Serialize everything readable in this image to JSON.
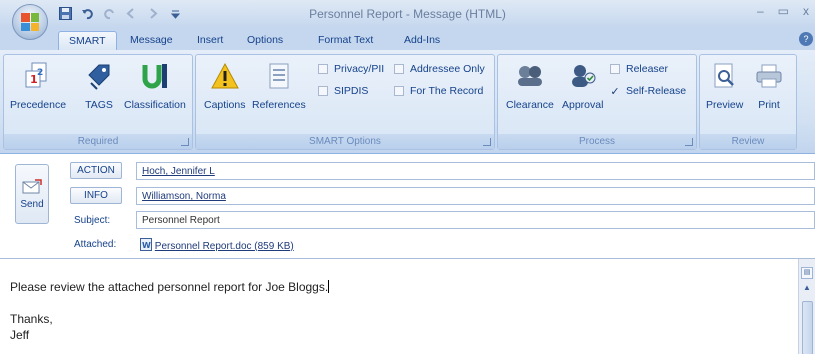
{
  "window": {
    "title": "Personnel Report - Message (HTML)",
    "minimize": "–",
    "restore": "▭",
    "close": "x"
  },
  "quick_access": [
    "save-icon",
    "undo-icon",
    "redo-icon",
    "back-icon",
    "forward-icon",
    "customize-icon"
  ],
  "tabs": [
    {
      "label": "SMART",
      "active": true
    },
    {
      "label": "Message"
    },
    {
      "label": "Insert"
    },
    {
      "label": "Options"
    },
    {
      "label": "Format Text"
    },
    {
      "label": "Add-Ins"
    }
  ],
  "ribbon": {
    "required": {
      "label": "Required",
      "buttons": [
        {
          "label": "Precedence",
          "icon": "precedence-icon"
        },
        {
          "label": "TAGS",
          "icon": "tags-icon"
        },
        {
          "label": "Classification",
          "icon": "classification-icon"
        }
      ]
    },
    "smart_options": {
      "label": "SMART Options",
      "buttons": [
        {
          "label": "Captions",
          "icon": "warning-icon"
        },
        {
          "label": "References",
          "icon": "document-icon"
        }
      ],
      "checkboxes": [
        {
          "label": "Privacy/PII",
          "checked": false
        },
        {
          "label": "SIPDIS",
          "checked": false
        },
        {
          "label": "Addressee Only",
          "checked": false
        },
        {
          "label": "For The Record",
          "checked": false
        }
      ]
    },
    "process": {
      "label": "Process",
      "buttons": [
        {
          "label": "Clearance",
          "icon": "clearance-icon"
        },
        {
          "label": "Approval",
          "icon": "approval-icon"
        }
      ],
      "checkboxes": [
        {
          "label": "Releaser",
          "checked": false
        },
        {
          "label": "Self-Release",
          "checked": true
        }
      ]
    },
    "review": {
      "label": "Review",
      "buttons": [
        {
          "label": "Preview",
          "icon": "preview-icon"
        },
        {
          "label": "Print",
          "icon": "print-icon"
        }
      ]
    }
  },
  "header": {
    "send_label": "Send",
    "action_label": "ACTION",
    "action_value": "Hoch, Jennifer L",
    "info_label": "INFO",
    "info_value": "Williamson, Norma",
    "subject_label": "Subject:",
    "subject_value": "Personnel Report",
    "attached_label": "Attached:",
    "attached_value": "Personnel Report.doc (859 KB)"
  },
  "body": {
    "line1": "Please review the attached personnel report for Joe Bloggs.",
    "line2": "Thanks,",
    "line3": "Jeff"
  },
  "colors": {
    "ribbon_text": "#15428b",
    "ribbon_bg": "#d1e0f2",
    "title_text": "#6a7f9e"
  }
}
